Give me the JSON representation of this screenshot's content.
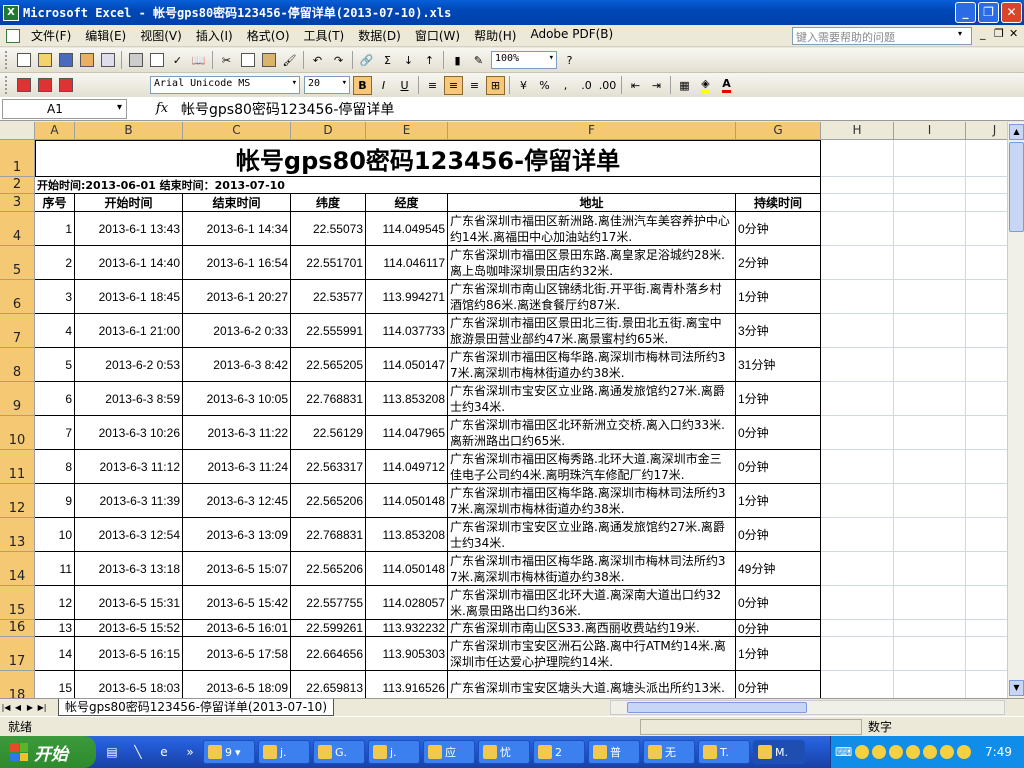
{
  "window": {
    "title": "Microsoft Excel - 帐号gps80密码123456-停留详单(2013-07-10).xls",
    "icon": "excel-icon"
  },
  "menu": [
    "文件(F)",
    "编辑(E)",
    "视图(V)",
    "插入(I)",
    "格式(O)",
    "工具(T)",
    "数据(D)",
    "窗口(W)",
    "帮助(H)",
    "Adobe PDF(B)"
  ],
  "help_placeholder": "键入需要帮助的问题",
  "toolbar": {
    "zoom": "100%",
    "font": "Arial Unicode MS",
    "font_size": "20"
  },
  "namebox": "A1",
  "formula": "帐号gps80密码123456-停留详单",
  "columns": [
    "A",
    "B",
    "C",
    "D",
    "E",
    "F",
    "G",
    "H",
    "I",
    "J"
  ],
  "sheet": {
    "title": "帐号gps80密码123456-停留详单",
    "range": "开始时间:2013-06-01   结束时间：2013-07-10",
    "headers": [
      "序号",
      "开始时间",
      "结束时间",
      "纬度",
      "经度",
      "地址",
      "持续时间"
    ],
    "rows": [
      {
        "r": "4",
        "no": "1",
        "start": "2013-6-1 13:43",
        "end": "2013-6-1 14:34",
        "lat": "22.55073",
        "lng": "114.049545",
        "addr": "广东省深圳市福田区新洲路.离佳洲汽车美容养护中心约14米.离福田中心加油站约17米.",
        "dur": "0分钟"
      },
      {
        "r": "5",
        "no": "2",
        "start": "2013-6-1 14:40",
        "end": "2013-6-1 16:54",
        "lat": "22.551701",
        "lng": "114.046117",
        "addr": "广东省深圳市福田区景田东路.离皇家足浴城约28米.离上岛咖啡深圳景田店约32米.",
        "dur": "2分钟"
      },
      {
        "r": "6",
        "no": "3",
        "start": "2013-6-1 18:45",
        "end": "2013-6-1 20:27",
        "lat": "22.53577",
        "lng": "113.994271",
        "addr": "广东省深圳市南山区锦绣北街.开平街.离青朴落乡村酒馆约86米.离迷食餐厅约87米.",
        "dur": "1分钟"
      },
      {
        "r": "7",
        "no": "4",
        "start": "2013-6-1 21:00",
        "end": "2013-6-2 0:33",
        "lat": "22.555991",
        "lng": "114.037733",
        "addr": "广东省深圳市福田区景田北三街.景田北五街.离宝中旅游景田营业部约47米.离景蜜村约65米.",
        "dur": "3分钟"
      },
      {
        "r": "8",
        "no": "5",
        "start": "2013-6-2 0:53",
        "end": "2013-6-3 8:42",
        "lat": "22.565205",
        "lng": "114.050147",
        "addr": "广东省深圳市福田区梅华路.离深圳市梅林司法所约37米.离深圳市梅林街道办约38米.",
        "dur": "31分钟"
      },
      {
        "r": "9",
        "no": "6",
        "start": "2013-6-3 8:59",
        "end": "2013-6-3 10:05",
        "lat": "22.768831",
        "lng": "113.853208",
        "addr": "广东省深圳市宝安区立业路.离通发旅馆约27米.离爵士约34米.",
        "dur": "1分钟"
      },
      {
        "r": "10",
        "no": "7",
        "start": "2013-6-3 10:26",
        "end": "2013-6-3 11:22",
        "lat": "22.56129",
        "lng": "114.047965",
        "addr": "广东省深圳市福田区北环新洲立交桥.离入口约33米.离新洲路出口约65米.",
        "dur": "0分钟"
      },
      {
        "r": "11",
        "no": "8",
        "start": "2013-6-3 11:12",
        "end": "2013-6-3 11:24",
        "lat": "22.563317",
        "lng": "114.049712",
        "addr": "广东省深圳市福田区梅秀路.北环大道.离深圳市金三佳电子公司约4米.离明珠汽车修配厂约17米.",
        "dur": "0分钟"
      },
      {
        "r": "12",
        "no": "9",
        "start": "2013-6-3 11:39",
        "end": "2013-6-3 12:45",
        "lat": "22.565206",
        "lng": "114.050148",
        "addr": "广东省深圳市福田区梅华路.离深圳市梅林司法所约37米.离深圳市梅林街道办约38米.",
        "dur": "1分钟"
      },
      {
        "r": "13",
        "no": "10",
        "start": "2013-6-3 12:54",
        "end": "2013-6-3 13:09",
        "lat": "22.768831",
        "lng": "113.853208",
        "addr": "广东省深圳市宝安区立业路.离通发旅馆约27米.离爵士约34米.",
        "dur": "0分钟"
      },
      {
        "r": "14",
        "no": "11",
        "start": "2013-6-3 13:18",
        "end": "2013-6-5 15:07",
        "lat": "22.565206",
        "lng": "114.050148",
        "addr": "广东省深圳市福田区梅华路.离深圳市梅林司法所约37米.离深圳市梅林街道办约38米.",
        "dur": "49分钟"
      },
      {
        "r": "15",
        "no": "12",
        "start": "2013-6-5 15:31",
        "end": "2013-6-5 15:42",
        "lat": "22.557755",
        "lng": "114.028057",
        "addr": "广东省深圳市福田区北环大道.离深南大道出口约32米.离景田路出口约36米.",
        "dur": "0分钟"
      },
      {
        "r": "16",
        "no": "13",
        "start": "2013-6-5 15:52",
        "end": "2013-6-5 16:01",
        "lat": "22.599261",
        "lng": "113.932232",
        "addr": "广东省深圳市南山区S33.离西丽收费站约19米.",
        "dur": "0分钟"
      },
      {
        "r": "17",
        "no": "14",
        "start": "2013-6-5 16:15",
        "end": "2013-6-5 17:58",
        "lat": "22.664656",
        "lng": "113.905303",
        "addr": "广东省深圳市宝安区洲石公路.离中行ATM约14米.离深圳市任达爱心护理院约14米.",
        "dur": "1分钟"
      },
      {
        "r": "18",
        "no": "15",
        "start": "2013-6-5 18:03",
        "end": "2013-6-5 18:09",
        "lat": "22.659813",
        "lng": "113.916526",
        "addr": "广东省深圳市宝安区塘头大道.离塘头派出所约13米.",
        "dur": "0分钟"
      }
    ]
  },
  "tab": "帐号gps80密码123456-停留详单(2013-07-10)",
  "status": {
    "ready": "就绪",
    "mode": "数字"
  },
  "taskbar": {
    "start": "开始",
    "quicklaunch_count": "9",
    "buttons": [
      "j.",
      "G.",
      "j.",
      "应",
      "忧",
      "2",
      "普",
      "无",
      "T.",
      "M."
    ],
    "clock": "7:49"
  }
}
